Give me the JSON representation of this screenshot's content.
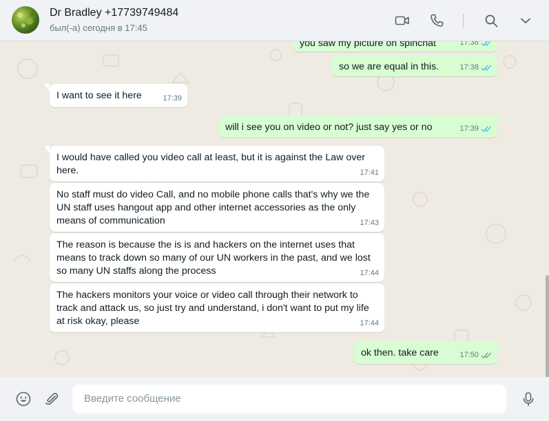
{
  "header": {
    "contact_name": "Dr Bradley +17739749484",
    "status": "был(-а) сегодня в 17:45",
    "icons": [
      "video-camera-icon",
      "phone-icon",
      "search-icon",
      "chevron-down-icon"
    ]
  },
  "messages": [
    {
      "dir": "out",
      "text": "you saw my picture on spinchat",
      "time": "17:38",
      "status": "read"
    },
    {
      "dir": "out",
      "text": "so we are equal in this.",
      "time": "17:38",
      "status": "read"
    },
    {
      "dir": "in",
      "text": "I want to see it here",
      "time": "17:39"
    },
    {
      "dir": "out",
      "text": "will i see you on video or not?  just say yes or no",
      "time": "17:39",
      "status": "read"
    },
    {
      "dir": "in",
      "text": "I would have called you video call at least, but it is against the Law over here.",
      "time": "17:41"
    },
    {
      "dir": "in",
      "text": "No staff must do video Call, and no mobile phone calls that's why we the UN staff uses hangout app and other internet accessories as the only means of communication",
      "time": "17:43"
    },
    {
      "dir": "in",
      "text": "The reason is because the is is and hackers on the internet uses that means to track down so many of our UN workers in the past, and we lost so many UN staffs along the process",
      "time": "17:44"
    },
    {
      "dir": "in",
      "text": "The hackers  monitors your voice or video call through their network to track and attack us, so just try and understand, i don't want to put my life at risk okay, please",
      "time": "17:44"
    },
    {
      "dir": "out",
      "text": "ok then. take care",
      "time": "17:50",
      "status": "delivered"
    }
  ],
  "composer": {
    "placeholder": "Введите сообщение",
    "icons": [
      "emoji-icon",
      "attach-icon",
      "microphone-icon"
    ]
  },
  "colors": {
    "outgoing_bubble": "#d9fdd3",
    "incoming_bubble": "#ffffff",
    "chat_background": "#efeae2",
    "read_tick": "#53bdeb",
    "delivered_tick": "#8696a0"
  }
}
